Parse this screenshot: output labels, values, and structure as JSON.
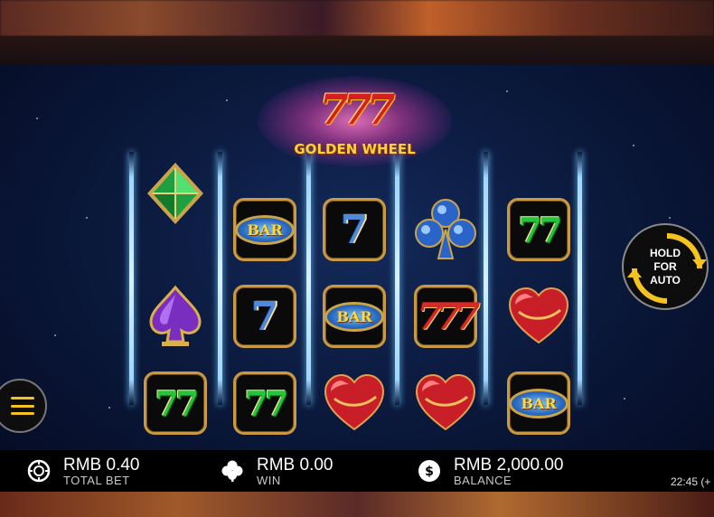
{
  "logo": {
    "sevens": "777",
    "title": "GOLDEN WHEEL"
  },
  "reels": [
    [
      "green-diamond",
      "purple-spade",
      "green-77"
    ],
    [
      "bar",
      "blue-7",
      "green-77"
    ],
    [
      "blue-7",
      "bar",
      "red-heart"
    ],
    [
      "blue-club",
      "red-777",
      "red-heart"
    ],
    [
      "green-77",
      "red-heart",
      "bar"
    ]
  ],
  "symbol_text": {
    "bar": "BAR",
    "blue_7": "7",
    "green_77": "77",
    "red_777": "777"
  },
  "hold_button": {
    "line1": "HOLD",
    "line2": "FOR",
    "line3": "AUTO"
  },
  "status_bar": {
    "total_bet": {
      "value": "RMB 0.40",
      "label": "TOTAL BET",
      "icon": "chip-icon"
    },
    "win": {
      "value": "RMB 0.00",
      "label": "WIN",
      "icon": "clover-icon"
    },
    "balance": {
      "value": "RMB 2,000.00",
      "label": "BALANCE",
      "icon": "dollar-coin-icon"
    },
    "clock": "22:45 (+"
  },
  "colors": {
    "accent": "#f6c220",
    "frame_gold": "#c99a42"
  }
}
